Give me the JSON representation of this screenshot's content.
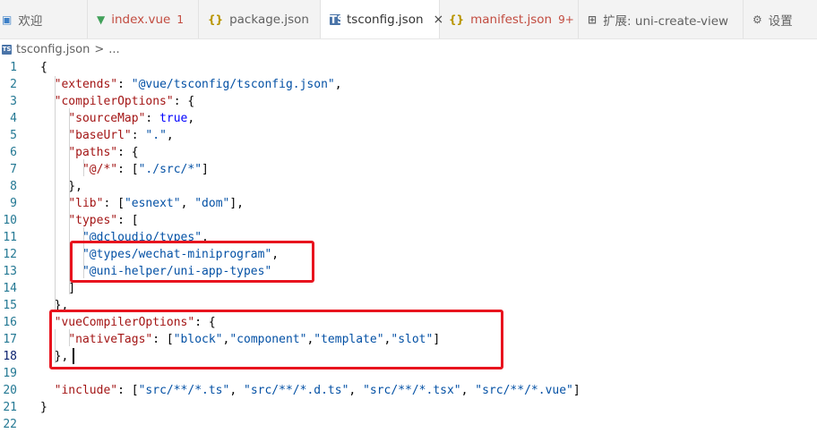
{
  "tabs": [
    {
      "label": "欢迎",
      "icon": "welcome-icon"
    },
    {
      "label": "index.vue",
      "badge": "1",
      "icon": "vue-file-icon"
    },
    {
      "label": "package.json",
      "icon": "json-file-icon"
    },
    {
      "label": "tsconfig.json",
      "icon": "ts-file-icon",
      "active": true,
      "close": "×"
    },
    {
      "label": "manifest.json",
      "badge": "9+",
      "icon": "json-file-icon"
    },
    {
      "label": "扩展: uni-create-view",
      "icon": "extensions-icon"
    },
    {
      "label": "设置",
      "icon": "settings-icon"
    }
  ],
  "icons": {
    "vue": "▼",
    "json": "{}",
    "ts": "TS",
    "ext": "⊞",
    "settings": "⚙"
  },
  "breadcrumb": {
    "file": "tsconfig.json",
    "separator": ">",
    "rest": "..."
  },
  "editor": {
    "current_line": 18,
    "line_numbers": [
      "1",
      "2",
      "3",
      "4",
      "5",
      "6",
      "7",
      "8",
      "9",
      "10",
      "11",
      "12",
      "13",
      "14",
      "15",
      "16",
      "17",
      "18",
      "19",
      "20",
      "21",
      "22"
    ],
    "lines": [
      [
        [
          "p",
          "{"
        ]
      ],
      [
        [
          "p",
          "  "
        ],
        [
          "k",
          "\"extends\""
        ],
        [
          "p",
          ": "
        ],
        [
          "s",
          "\"@vue/tsconfig/tsconfig.json\""
        ],
        [
          "p",
          ","
        ]
      ],
      [
        [
          "p",
          "  "
        ],
        [
          "k",
          "\"compilerOptions\""
        ],
        [
          "p",
          ": {"
        ]
      ],
      [
        [
          "p",
          "    "
        ],
        [
          "k",
          "\"sourceMap\""
        ],
        [
          "p",
          ": "
        ],
        [
          "kw",
          "true"
        ],
        [
          "p",
          ","
        ]
      ],
      [
        [
          "p",
          "    "
        ],
        [
          "k",
          "\"baseUrl\""
        ],
        [
          "p",
          ": "
        ],
        [
          "s",
          "\".\""
        ],
        [
          "p",
          ","
        ]
      ],
      [
        [
          "p",
          "    "
        ],
        [
          "k",
          "\"paths\""
        ],
        [
          "p",
          ": {"
        ]
      ],
      [
        [
          "p",
          "      "
        ],
        [
          "k",
          "\"@/*\""
        ],
        [
          "p",
          ": ["
        ],
        [
          "s",
          "\"./src/*\""
        ],
        [
          "p",
          "]"
        ]
      ],
      [
        [
          "p",
          "    },"
        ]
      ],
      [
        [
          "p",
          "    "
        ],
        [
          "k",
          "\"lib\""
        ],
        [
          "p",
          ": ["
        ],
        [
          "s",
          "\"esnext\""
        ],
        [
          "p",
          ", "
        ],
        [
          "s",
          "\"dom\""
        ],
        [
          "p",
          "],"
        ]
      ],
      [
        [
          "p",
          "    "
        ],
        [
          "k",
          "\"types\""
        ],
        [
          "p",
          ": ["
        ]
      ],
      [
        [
          "p",
          "      "
        ],
        [
          "s",
          "\"@dcloudio/types\""
        ],
        [
          "p",
          ","
        ]
      ],
      [
        [
          "p",
          "      "
        ],
        [
          "s",
          "\"@types/wechat-miniprogram\""
        ],
        [
          "p",
          ","
        ]
      ],
      [
        [
          "p",
          "      "
        ],
        [
          "s",
          "\"@uni-helper/uni-app-types\""
        ]
      ],
      [
        [
          "p",
          "    ]"
        ]
      ],
      [
        [
          "p",
          "  },"
        ]
      ],
      [
        [
          "p",
          "  "
        ],
        [
          "k",
          "\"vueCompilerOptions\""
        ],
        [
          "p",
          ": {"
        ]
      ],
      [
        [
          "p",
          "    "
        ],
        [
          "k",
          "\"nativeTags\""
        ],
        [
          "p",
          ": ["
        ],
        [
          "s",
          "\"block\""
        ],
        [
          "p",
          ","
        ],
        [
          "s",
          "\"component\""
        ],
        [
          "p",
          ","
        ],
        [
          "s",
          "\"template\""
        ],
        [
          "p",
          ","
        ],
        [
          "s",
          "\"slot\""
        ],
        [
          "p",
          "]"
        ]
      ],
      [
        [
          "p",
          "  },"
        ]
      ],
      [
        [
          "p",
          ""
        ]
      ],
      [
        [
          "p",
          "  "
        ],
        [
          "k",
          "\"include\""
        ],
        [
          "p",
          ": ["
        ],
        [
          "s",
          "\"src/**/*.ts\""
        ],
        [
          "p",
          ", "
        ],
        [
          "s",
          "\"src/**/*.d.ts\""
        ],
        [
          "p",
          ", "
        ],
        [
          "s",
          "\"src/**/*.tsx\""
        ],
        [
          "p",
          ", "
        ],
        [
          "s",
          "\"src/**/*.vue\""
        ],
        [
          "p",
          "]"
        ]
      ],
      [
        [
          "p",
          "}"
        ]
      ],
      [
        [
          "p",
          ""
        ]
      ]
    ]
  },
  "colors": {
    "key": "#a31515",
    "string": "#0451a5",
    "keyword": "#0000ff",
    "line_number": "#237893",
    "highlight_box": "#e8141e"
  }
}
